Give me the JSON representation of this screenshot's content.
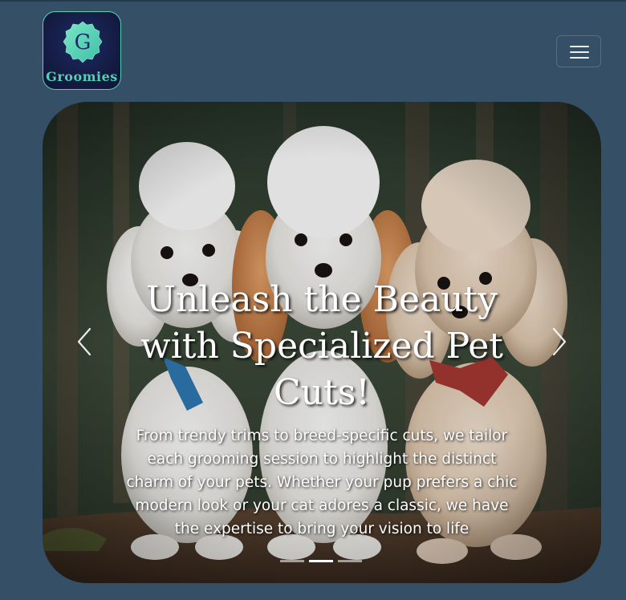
{
  "brand": {
    "logo_letter": "G",
    "name": "Groomies",
    "accent_color": "#53cfb2"
  },
  "navbar": {
    "toggler_icon": "hamburger-menu-icon"
  },
  "carousel": {
    "title": "Unleash the Beauty with Specialized Pet Cuts!",
    "text": "From trendy trims to breed-specific cuts, we tailor each grooming session to highlight the distinct charm of your pets. Whether your pup prefers a chic modern look or your cat adores a classic, we have the expertise to bring your vision to life",
    "prev_icon": "chevron-left-icon",
    "next_icon": "chevron-right-icon",
    "slide_count": 3,
    "active_slide": 2
  },
  "colors": {
    "page_background": "#355066",
    "caption_text": "#ffffff"
  }
}
